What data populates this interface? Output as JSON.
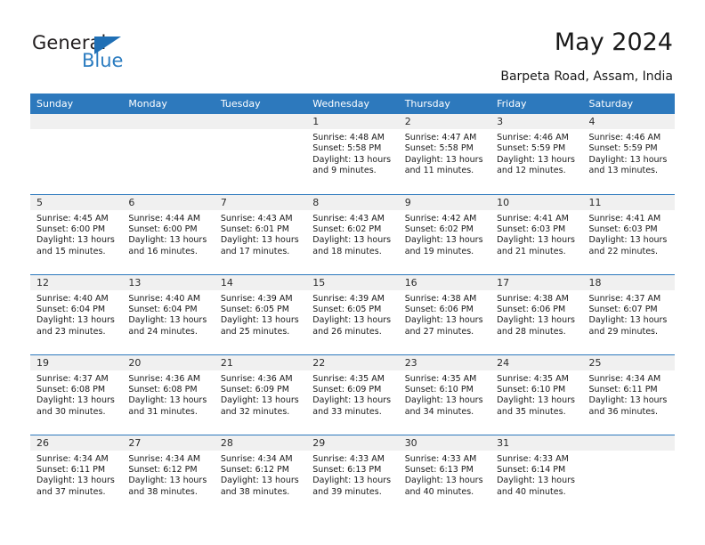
{
  "brand": {
    "name_part1": "General",
    "name_part2": "Blue",
    "triangle_color": "#1f6fb5",
    "blue_color": "#2b7cc0"
  },
  "header": {
    "title": "May 2024",
    "subtitle": "Barpeta Road, Assam, India"
  },
  "theme": {
    "header_bg": "#2d79bd",
    "daynum_bg": "#f0f0f0",
    "text": "#1a1a1a"
  },
  "weekdays": [
    "Sunday",
    "Monday",
    "Tuesday",
    "Wednesday",
    "Thursday",
    "Friday",
    "Saturday"
  ],
  "labels": {
    "sunrise": "Sunrise:",
    "sunset": "Sunset:",
    "daylight": "Daylight:"
  },
  "weeks": [
    [
      {
        "day": "",
        "sunrise": "",
        "sunset": "",
        "daylight_line1": "",
        "daylight_line2": "",
        "empty": true
      },
      {
        "day": "",
        "sunrise": "",
        "sunset": "",
        "daylight_line1": "",
        "daylight_line2": "",
        "empty": true
      },
      {
        "day": "",
        "sunrise": "",
        "sunset": "",
        "daylight_line1": "",
        "daylight_line2": "",
        "empty": true
      },
      {
        "day": "1",
        "sunrise": "Sunrise: 4:48 AM",
        "sunset": "Sunset: 5:58 PM",
        "daylight_line1": "Daylight: 13 hours",
        "daylight_line2": "and 9 minutes.",
        "empty": false
      },
      {
        "day": "2",
        "sunrise": "Sunrise: 4:47 AM",
        "sunset": "Sunset: 5:58 PM",
        "daylight_line1": "Daylight: 13 hours",
        "daylight_line2": "and 11 minutes.",
        "empty": false
      },
      {
        "day": "3",
        "sunrise": "Sunrise: 4:46 AM",
        "sunset": "Sunset: 5:59 PM",
        "daylight_line1": "Daylight: 13 hours",
        "daylight_line2": "and 12 minutes.",
        "empty": false
      },
      {
        "day": "4",
        "sunrise": "Sunrise: 4:46 AM",
        "sunset": "Sunset: 5:59 PM",
        "daylight_line1": "Daylight: 13 hours",
        "daylight_line2": "and 13 minutes.",
        "empty": false
      }
    ],
    [
      {
        "day": "5",
        "sunrise": "Sunrise: 4:45 AM",
        "sunset": "Sunset: 6:00 PM",
        "daylight_line1": "Daylight: 13 hours",
        "daylight_line2": "and 15 minutes.",
        "empty": false
      },
      {
        "day": "6",
        "sunrise": "Sunrise: 4:44 AM",
        "sunset": "Sunset: 6:00 PM",
        "daylight_line1": "Daylight: 13 hours",
        "daylight_line2": "and 16 minutes.",
        "empty": false
      },
      {
        "day": "7",
        "sunrise": "Sunrise: 4:43 AM",
        "sunset": "Sunset: 6:01 PM",
        "daylight_line1": "Daylight: 13 hours",
        "daylight_line2": "and 17 minutes.",
        "empty": false
      },
      {
        "day": "8",
        "sunrise": "Sunrise: 4:43 AM",
        "sunset": "Sunset: 6:02 PM",
        "daylight_line1": "Daylight: 13 hours",
        "daylight_line2": "and 18 minutes.",
        "empty": false
      },
      {
        "day": "9",
        "sunrise": "Sunrise: 4:42 AM",
        "sunset": "Sunset: 6:02 PM",
        "daylight_line1": "Daylight: 13 hours",
        "daylight_line2": "and 19 minutes.",
        "empty": false
      },
      {
        "day": "10",
        "sunrise": "Sunrise: 4:41 AM",
        "sunset": "Sunset: 6:03 PM",
        "daylight_line1": "Daylight: 13 hours",
        "daylight_line2": "and 21 minutes.",
        "empty": false
      },
      {
        "day": "11",
        "sunrise": "Sunrise: 4:41 AM",
        "sunset": "Sunset: 6:03 PM",
        "daylight_line1": "Daylight: 13 hours",
        "daylight_line2": "and 22 minutes.",
        "empty": false
      }
    ],
    [
      {
        "day": "12",
        "sunrise": "Sunrise: 4:40 AM",
        "sunset": "Sunset: 6:04 PM",
        "daylight_line1": "Daylight: 13 hours",
        "daylight_line2": "and 23 minutes.",
        "empty": false
      },
      {
        "day": "13",
        "sunrise": "Sunrise: 4:40 AM",
        "sunset": "Sunset: 6:04 PM",
        "daylight_line1": "Daylight: 13 hours",
        "daylight_line2": "and 24 minutes.",
        "empty": false
      },
      {
        "day": "14",
        "sunrise": "Sunrise: 4:39 AM",
        "sunset": "Sunset: 6:05 PM",
        "daylight_line1": "Daylight: 13 hours",
        "daylight_line2": "and 25 minutes.",
        "empty": false
      },
      {
        "day": "15",
        "sunrise": "Sunrise: 4:39 AM",
        "sunset": "Sunset: 6:05 PM",
        "daylight_line1": "Daylight: 13 hours",
        "daylight_line2": "and 26 minutes.",
        "empty": false
      },
      {
        "day": "16",
        "sunrise": "Sunrise: 4:38 AM",
        "sunset": "Sunset: 6:06 PM",
        "daylight_line1": "Daylight: 13 hours",
        "daylight_line2": "and 27 minutes.",
        "empty": false
      },
      {
        "day": "17",
        "sunrise": "Sunrise: 4:38 AM",
        "sunset": "Sunset: 6:06 PM",
        "daylight_line1": "Daylight: 13 hours",
        "daylight_line2": "and 28 minutes.",
        "empty": false
      },
      {
        "day": "18",
        "sunrise": "Sunrise: 4:37 AM",
        "sunset": "Sunset: 6:07 PM",
        "daylight_line1": "Daylight: 13 hours",
        "daylight_line2": "and 29 minutes.",
        "empty": false
      }
    ],
    [
      {
        "day": "19",
        "sunrise": "Sunrise: 4:37 AM",
        "sunset": "Sunset: 6:08 PM",
        "daylight_line1": "Daylight: 13 hours",
        "daylight_line2": "and 30 minutes.",
        "empty": false
      },
      {
        "day": "20",
        "sunrise": "Sunrise: 4:36 AM",
        "sunset": "Sunset: 6:08 PM",
        "daylight_line1": "Daylight: 13 hours",
        "daylight_line2": "and 31 minutes.",
        "empty": false
      },
      {
        "day": "21",
        "sunrise": "Sunrise: 4:36 AM",
        "sunset": "Sunset: 6:09 PM",
        "daylight_line1": "Daylight: 13 hours",
        "daylight_line2": "and 32 minutes.",
        "empty": false
      },
      {
        "day": "22",
        "sunrise": "Sunrise: 4:35 AM",
        "sunset": "Sunset: 6:09 PM",
        "daylight_line1": "Daylight: 13 hours",
        "daylight_line2": "and 33 minutes.",
        "empty": false
      },
      {
        "day": "23",
        "sunrise": "Sunrise: 4:35 AM",
        "sunset": "Sunset: 6:10 PM",
        "daylight_line1": "Daylight: 13 hours",
        "daylight_line2": "and 34 minutes.",
        "empty": false
      },
      {
        "day": "24",
        "sunrise": "Sunrise: 4:35 AM",
        "sunset": "Sunset: 6:10 PM",
        "daylight_line1": "Daylight: 13 hours",
        "daylight_line2": "and 35 minutes.",
        "empty": false
      },
      {
        "day": "25",
        "sunrise": "Sunrise: 4:34 AM",
        "sunset": "Sunset: 6:11 PM",
        "daylight_line1": "Daylight: 13 hours",
        "daylight_line2": "and 36 minutes.",
        "empty": false
      }
    ],
    [
      {
        "day": "26",
        "sunrise": "Sunrise: 4:34 AM",
        "sunset": "Sunset: 6:11 PM",
        "daylight_line1": "Daylight: 13 hours",
        "daylight_line2": "and 37 minutes.",
        "empty": false
      },
      {
        "day": "27",
        "sunrise": "Sunrise: 4:34 AM",
        "sunset": "Sunset: 6:12 PM",
        "daylight_line1": "Daylight: 13 hours",
        "daylight_line2": "and 38 minutes.",
        "empty": false
      },
      {
        "day": "28",
        "sunrise": "Sunrise: 4:34 AM",
        "sunset": "Sunset: 6:12 PM",
        "daylight_line1": "Daylight: 13 hours",
        "daylight_line2": "and 38 minutes.",
        "empty": false
      },
      {
        "day": "29",
        "sunrise": "Sunrise: 4:33 AM",
        "sunset": "Sunset: 6:13 PM",
        "daylight_line1": "Daylight: 13 hours",
        "daylight_line2": "and 39 minutes.",
        "empty": false
      },
      {
        "day": "30",
        "sunrise": "Sunrise: 4:33 AM",
        "sunset": "Sunset: 6:13 PM",
        "daylight_line1": "Daylight: 13 hours",
        "daylight_line2": "and 40 minutes.",
        "empty": false
      },
      {
        "day": "31",
        "sunrise": "Sunrise: 4:33 AM",
        "sunset": "Sunset: 6:14 PM",
        "daylight_line1": "Daylight: 13 hours",
        "daylight_line2": "and 40 minutes.",
        "empty": false
      },
      {
        "day": "",
        "sunrise": "",
        "sunset": "",
        "daylight_line1": "",
        "daylight_line2": "",
        "empty": true
      }
    ]
  ]
}
